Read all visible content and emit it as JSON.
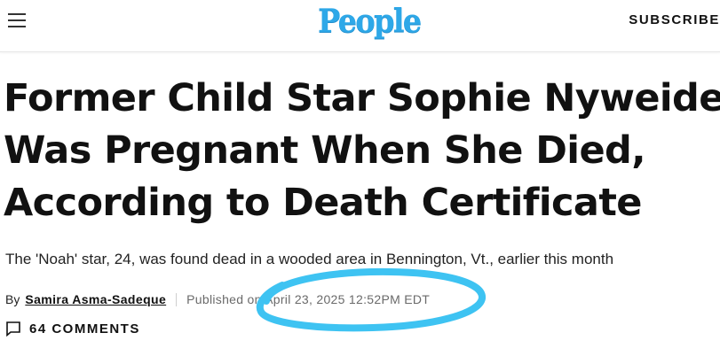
{
  "header": {
    "menu_icon": "hamburger-menu-icon",
    "logo": "People",
    "subscribe_label": "SUBSCRIBE"
  },
  "article": {
    "headline_lines": [
      "Former Child Star Sophie Nyweide",
      "Was Pregnant When She Died,",
      "According to Death Certificate"
    ],
    "dek": "The 'Noah' star, 24, was found dead in a wooded area in Bennington, Vt., earlier this month",
    "byline": {
      "prefix": "By",
      "author": "Samira Asma-Sadeque",
      "published": "Published on April 23, 2025 12:52PM EDT"
    },
    "comments": {
      "icon": "comment-bubble-icon",
      "label": "64 COMMENTS"
    }
  },
  "colors": {
    "logo": "#2ea8e8",
    "annotation_highlight": "#3ec3f2",
    "text": "#111111"
  }
}
